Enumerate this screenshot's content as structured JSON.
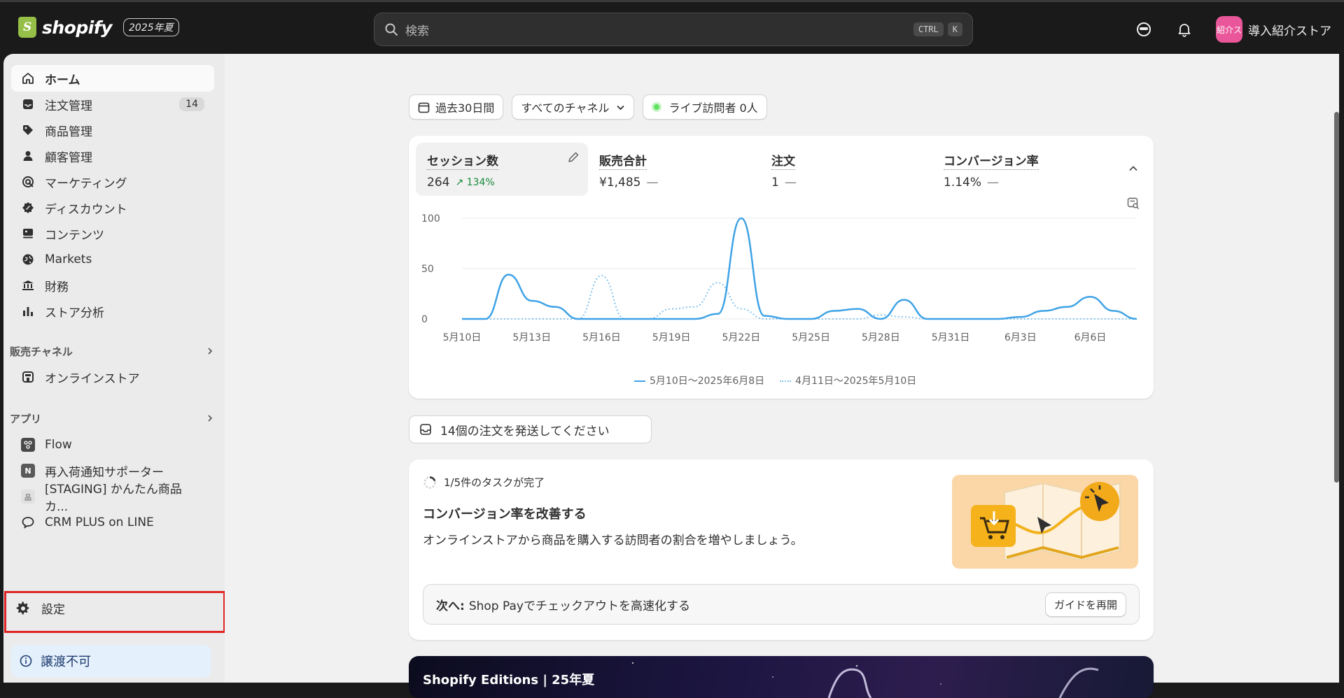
{
  "topbar": {
    "logo_text": "shopify",
    "edition_badge": "2025年夏",
    "search_placeholder": "検索",
    "kbd_ctrl": "CTRL",
    "kbd_k": "K",
    "avatar_text": "紹介ス",
    "store_name": "導入紹介ストア"
  },
  "sidebar": {
    "items": [
      {
        "label": "ホーム"
      },
      {
        "label": "注文管理",
        "badge": "14"
      },
      {
        "label": "商品管理"
      },
      {
        "label": "顧客管理"
      },
      {
        "label": "マーケティング"
      },
      {
        "label": "ディスカウント"
      },
      {
        "label": "コンテンツ"
      },
      {
        "label": "Markets"
      },
      {
        "label": "財務"
      },
      {
        "label": "ストア分析"
      }
    ],
    "sales_channels_heading": "販売チャネル",
    "sales_channels": [
      {
        "label": "オンラインストア"
      }
    ],
    "apps_heading": "アプリ",
    "apps": [
      {
        "label": "Flow"
      },
      {
        "label": "再入荷通知サポーター"
      },
      {
        "label": "[STAGING] かんたん商品カ..."
      },
      {
        "label": "CRM PLUS on LINE"
      }
    ],
    "settings_label": "設定",
    "notice_label": "譲渡不可"
  },
  "filters": {
    "date_range": "過去30日間",
    "channel": "すべてのチャネル",
    "live_visitors": "ライブ訪問者 0人"
  },
  "metrics": [
    {
      "label": "セッション数",
      "value": "264",
      "trend": "134%"
    },
    {
      "label": "販売合計",
      "value": "¥1,485",
      "trend": "—"
    },
    {
      "label": "注文",
      "value": "1",
      "trend": "—"
    },
    {
      "label": "コンバージョン率",
      "value": "1.14%",
      "trend": "—"
    }
  ],
  "chart_data": {
    "type": "line",
    "x": [
      "5月10日",
      "5月11日",
      "5月12日",
      "5月13日",
      "5月14日",
      "5月15日",
      "5月16日",
      "5月17日",
      "5月18日",
      "5月19日",
      "5月20日",
      "5月21日",
      "5月22日",
      "5月23日",
      "5月24日",
      "5月25日",
      "5月26日",
      "5月27日",
      "5月28日",
      "5月29日",
      "5月30日",
      "5月31日",
      "6月1日",
      "6月2日",
      "6月3日",
      "6月4日",
      "6月5日",
      "6月6日",
      "6月7日",
      "6月8日"
    ],
    "xticks": [
      "5月10日",
      "5月13日",
      "5月16日",
      "5月19日",
      "5月22日",
      "5月25日",
      "5月28日",
      "5月31日",
      "6月3日",
      "6月6日"
    ],
    "ylim": [
      0,
      100
    ],
    "yticks": [
      0,
      50,
      100
    ],
    "series": [
      {
        "name": "5月10日〜2025年6月8日",
        "color": "#3fa3e6",
        "style": "solid",
        "values": [
          0,
          0,
          44,
          18,
          12,
          0,
          0,
          0,
          0,
          0,
          0,
          5,
          100,
          3,
          0,
          0,
          8,
          10,
          0,
          19,
          0,
          0,
          0,
          0,
          2,
          8,
          12,
          22,
          8,
          0
        ]
      },
      {
        "name": "4月11日〜2025年5月10日",
        "color": "#86c3ee",
        "style": "dotted",
        "values": [
          0,
          0,
          0,
          0,
          0,
          0,
          43,
          0,
          0,
          10,
          12,
          36,
          10,
          0,
          0,
          0,
          0,
          0,
          4,
          2,
          0,
          0,
          0,
          0,
          0,
          0,
          0,
          0,
          0,
          0
        ]
      }
    ]
  },
  "ship_notice": "14個の注文を発送してください",
  "task_card": {
    "progress": "1/5件のタスクが完了",
    "title": "コンバージョン率を改善する",
    "description": "オンラインストアから商品を購入する訪問者の割合を増やしましょう。",
    "next_prefix": "次へ:",
    "next_text": "Shop Payでチェックアウトを高速化する",
    "resume_button": "ガイドを再開"
  },
  "banner_title": "Shopify Editions | 25年夏"
}
